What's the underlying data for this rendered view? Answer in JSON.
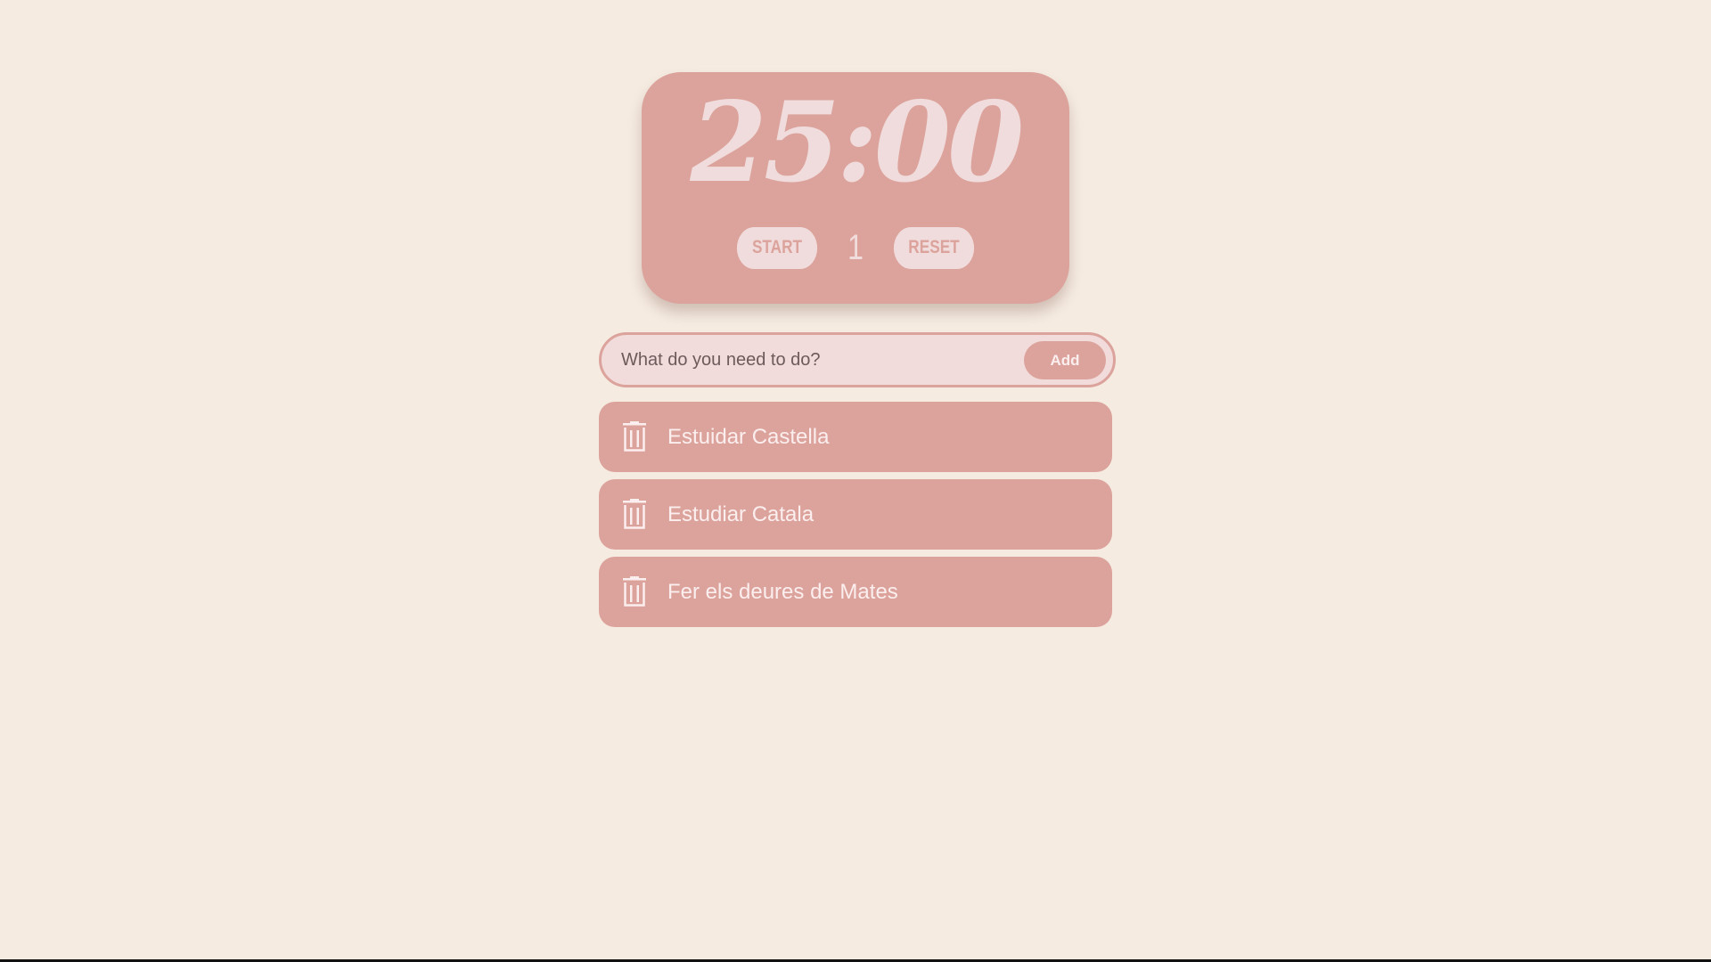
{
  "timer": {
    "time": "25:00",
    "start_label": "START",
    "session_count": "1",
    "reset_label": "RESET"
  },
  "todo_form": {
    "placeholder": "What do you need to do?",
    "add_label": "Add"
  },
  "todos": [
    {
      "text": "Estuidar Castella",
      "icon": "trash-icon"
    },
    {
      "text": "Estudiar Catala",
      "icon": "trash-icon"
    },
    {
      "text": "Fer els deures de Mates",
      "icon": "trash-icon"
    }
  ],
  "colors": {
    "background": "#f5ebe1",
    "accent": "#dca39c",
    "light": "#f0dcdc",
    "item_text": "#fbeeee"
  }
}
